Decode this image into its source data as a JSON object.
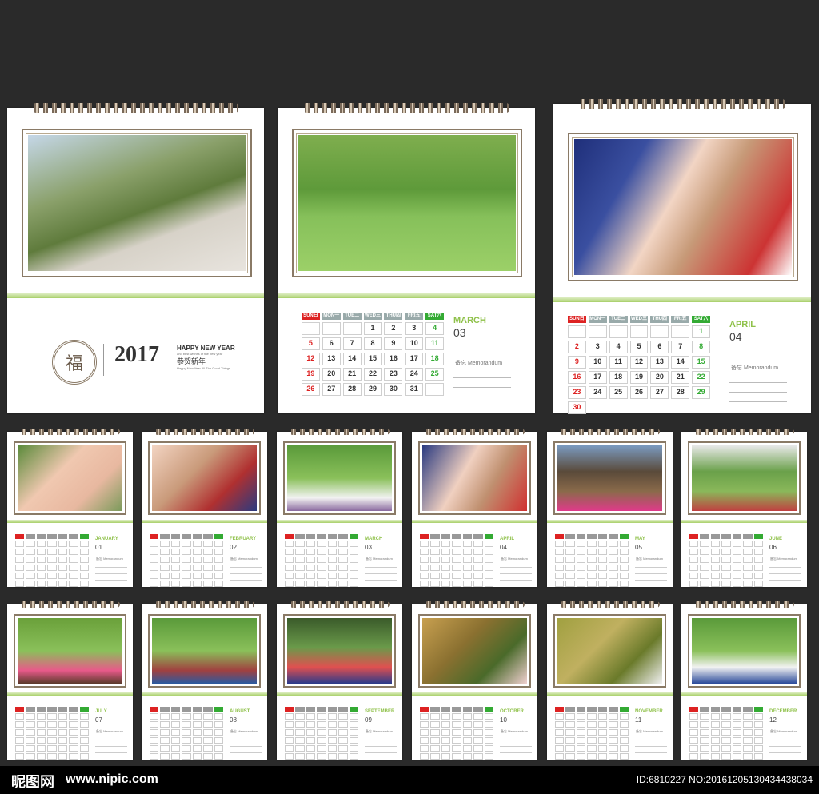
{
  "cover": {
    "year": "2017",
    "greeting": "HAPPY NEW YEAR",
    "greeting_sub": "and best wishes of the new year",
    "chinese": "恭贺新年",
    "tagline": "Happy New Year All The Good Things",
    "seal_char": "福"
  },
  "weekdays": [
    "SUN日",
    "MON一",
    "TUE二",
    "WED三",
    "THU四",
    "FRI五",
    "SAT六"
  ],
  "memo_label": "备忘 Memorandum",
  "march": {
    "name": "MARCH",
    "num": "03",
    "days": [
      "",
      "",
      "",
      "1",
      "2",
      "3",
      "4",
      "5",
      "6",
      "7",
      "8",
      "9",
      "10",
      "11",
      "12",
      "13",
      "14",
      "15",
      "16",
      "17",
      "18",
      "19",
      "20",
      "21",
      "22",
      "23",
      "24",
      "25",
      "26",
      "27",
      "28",
      "29",
      "30",
      "31",
      ""
    ]
  },
  "april": {
    "name": "APRIL",
    "num": "04",
    "days": [
      "",
      "",
      "",
      "",
      "",
      "",
      "1",
      "2",
      "3",
      "4",
      "5",
      "6",
      "7",
      "8",
      "9",
      "10",
      "11",
      "12",
      "13",
      "14",
      "15",
      "16",
      "17",
      "18",
      "19",
      "20",
      "21",
      "22",
      "23",
      "24",
      "25",
      "26",
      "27",
      "28",
      "29",
      "30"
    ]
  },
  "months_small": [
    {
      "name": "JANUARY",
      "num": "01"
    },
    {
      "name": "FEBRUARY",
      "num": "02"
    },
    {
      "name": "MARCH",
      "num": "03"
    },
    {
      "name": "APRIL",
      "num": "04"
    },
    {
      "name": "MAY",
      "num": "05"
    },
    {
      "name": "JUNE",
      "num": "06"
    },
    {
      "name": "JULY",
      "num": "07"
    },
    {
      "name": "AUGUST",
      "num": "08"
    },
    {
      "name": "SEPTEMBER",
      "num": "09"
    },
    {
      "name": "OCTOBER",
      "num": "10"
    },
    {
      "name": "NOVEMBER",
      "num": "11"
    },
    {
      "name": "DECEMBER",
      "num": "12"
    }
  ],
  "footer": {
    "logo": "昵图网",
    "site": "www.nipic.com",
    "id": "ID:6810227 NO:20161205130434438034"
  },
  "colors": {
    "accent": "#8fc14a",
    "sunday": "#dd2222",
    "saturday": "#33aa33"
  }
}
